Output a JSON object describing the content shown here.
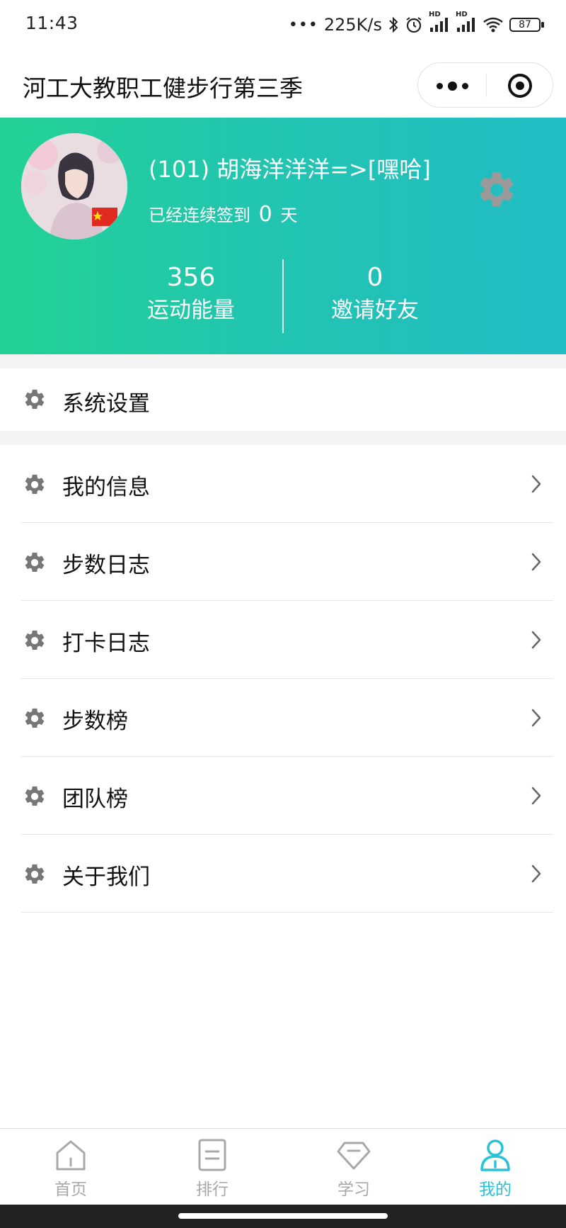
{
  "status_bar": {
    "time": "11:43",
    "speed": "225K/s",
    "battery": "87",
    "hd1": "HD",
    "hd2": "HD"
  },
  "header": {
    "title": "河工大教职工健步行第三季"
  },
  "profile": {
    "name": "(101) 胡海洋洋洋=>[嘿哈]",
    "signin_prefix": "已经连续签到",
    "signin_days": "0",
    "signin_suffix": "天",
    "stats": {
      "energy_value": "356",
      "energy_label": "运动能量",
      "invite_value": "0",
      "invite_label": "邀请好友"
    }
  },
  "menu": {
    "system_settings": "系统设置",
    "items": [
      {
        "label": "我的信息"
      },
      {
        "label": "步数日志"
      },
      {
        "label": "打卡日志"
      },
      {
        "label": "步数榜"
      },
      {
        "label": "团队榜"
      },
      {
        "label": "关于我们"
      }
    ]
  },
  "tabbar": {
    "tabs": [
      {
        "label": "首页",
        "icon": "home-icon"
      },
      {
        "label": "排行",
        "icon": "list-icon"
      },
      {
        "label": "学习",
        "icon": "diamond-icon"
      },
      {
        "label": "我的",
        "icon": "person-icon"
      }
    ],
    "active_index": 3
  },
  "colors": {
    "banner_start": "#23d195",
    "banner_end": "#22bcc4",
    "accent": "#27c3d8",
    "icon_gray": "#777777"
  }
}
